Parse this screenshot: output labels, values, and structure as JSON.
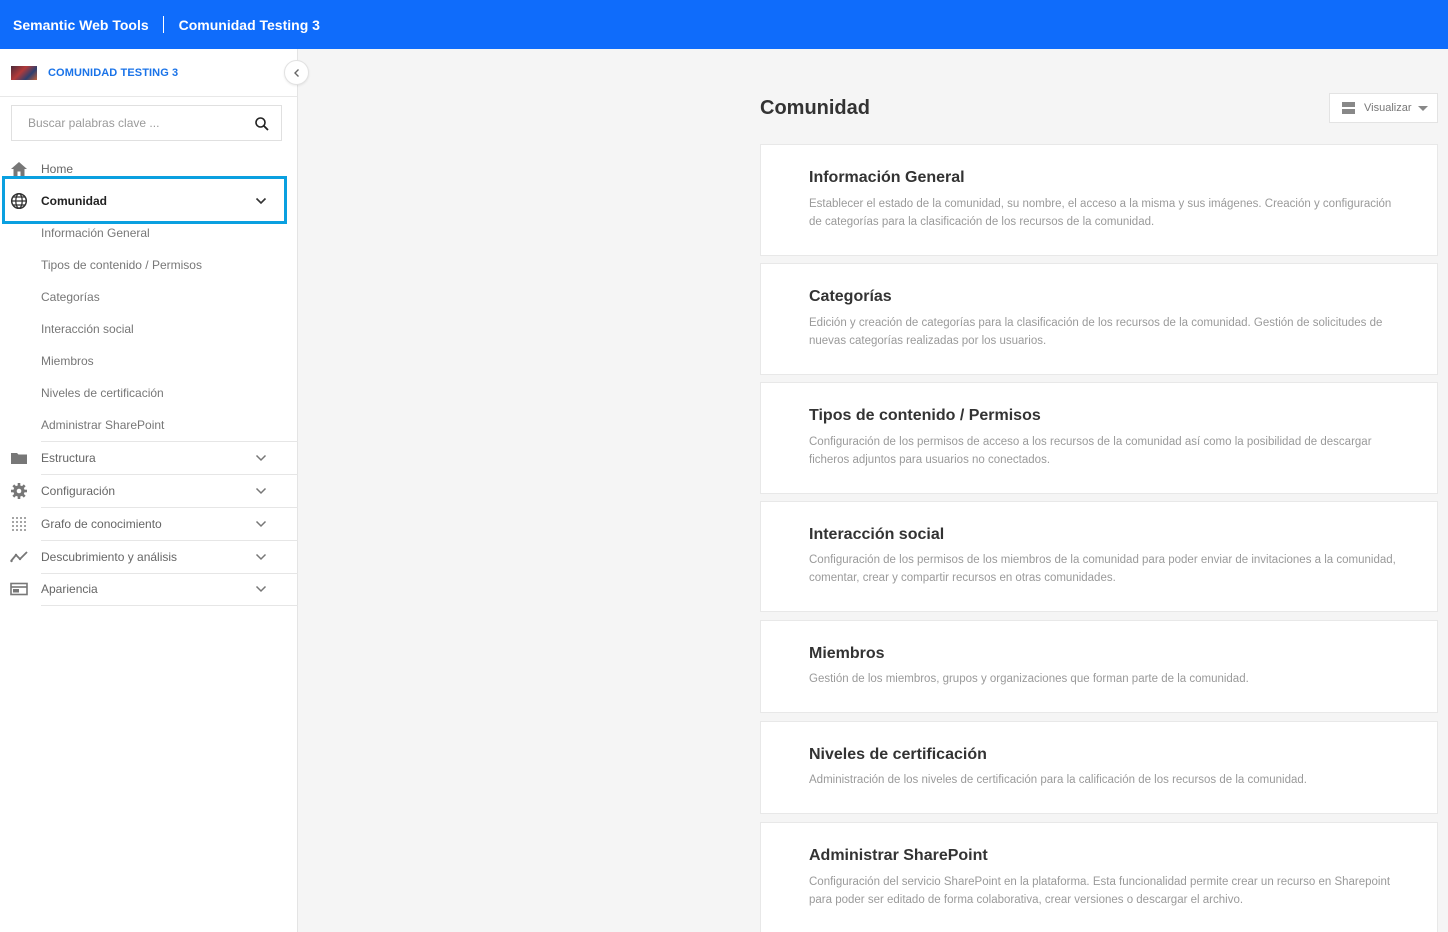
{
  "topbar": {
    "app_name": "Semantic Web Tools",
    "community_name": "Comunidad Testing 3"
  },
  "sidebar": {
    "community_title": "COMUNIDAD TESTING 3",
    "search_placeholder": "Buscar palabras clave ...",
    "items": [
      {
        "label": "Home",
        "icon": "home-icon"
      },
      {
        "label": "Comunidad",
        "icon": "globe-icon",
        "expanded": true
      },
      {
        "label": "Estructura",
        "icon": "folder-icon"
      },
      {
        "label": "Configuración",
        "icon": "gear-icon"
      },
      {
        "label": "Grafo de conocimiento",
        "icon": "graph-icon"
      },
      {
        "label": "Descubrimiento y análisis",
        "icon": "trend-icon"
      },
      {
        "label": "Apariencia",
        "icon": "layout-icon"
      }
    ],
    "subitems": [
      "Información General",
      "Tipos de contenido / Permisos",
      "Categorías",
      "Interacción social",
      "Miembros",
      "Niveles de certificación",
      "Administrar SharePoint"
    ]
  },
  "main": {
    "title": "Comunidad",
    "view_button": "Visualizar",
    "cards": [
      {
        "title": "Información General",
        "desc": "Establecer el estado de la comunidad, su nombre, el acceso a la misma y sus imágenes. Creación y configuración de categorías para la clasificación de los recursos de la comunidad."
      },
      {
        "title": "Categorías",
        "desc": "Edición y creación de categorías para la clasificación de los recursos de la comunidad. Gestión de solicitudes de nuevas categorías realizadas por los usuarios."
      },
      {
        "title": "Tipos de contenido / Permisos",
        "desc": "Configuración de los permisos de acceso a los recursos de la comunidad así como la posibilidad de descargar ficheros adjuntos para usuarios no conectados."
      },
      {
        "title": "Interacción social",
        "desc": "Configuración de los permisos de los miembros de la comunidad para poder enviar de invitaciones a la comunidad, comentar, crear y compartir recursos en otras comunidades."
      },
      {
        "title": "Miembros",
        "desc": "Gestión de los miembros, grupos y organizaciones que forman parte de la comunidad."
      },
      {
        "title": "Niveles de certificación",
        "desc": "Administración de los niveles de certificación para la calificación de los recursos de la comunidad."
      },
      {
        "title": "Administrar SharePoint",
        "desc": "Configuración del servicio SharePoint en la plataforma. Esta funcionalidad permite crear un recurso en Sharepoint para poder ser editado de forma colaborativa, crear versiones o descargar el archivo."
      }
    ]
  },
  "colors": {
    "topbar": "#0f6cfb",
    "link": "#1a73e8",
    "highlight": "#0aa0e0"
  }
}
